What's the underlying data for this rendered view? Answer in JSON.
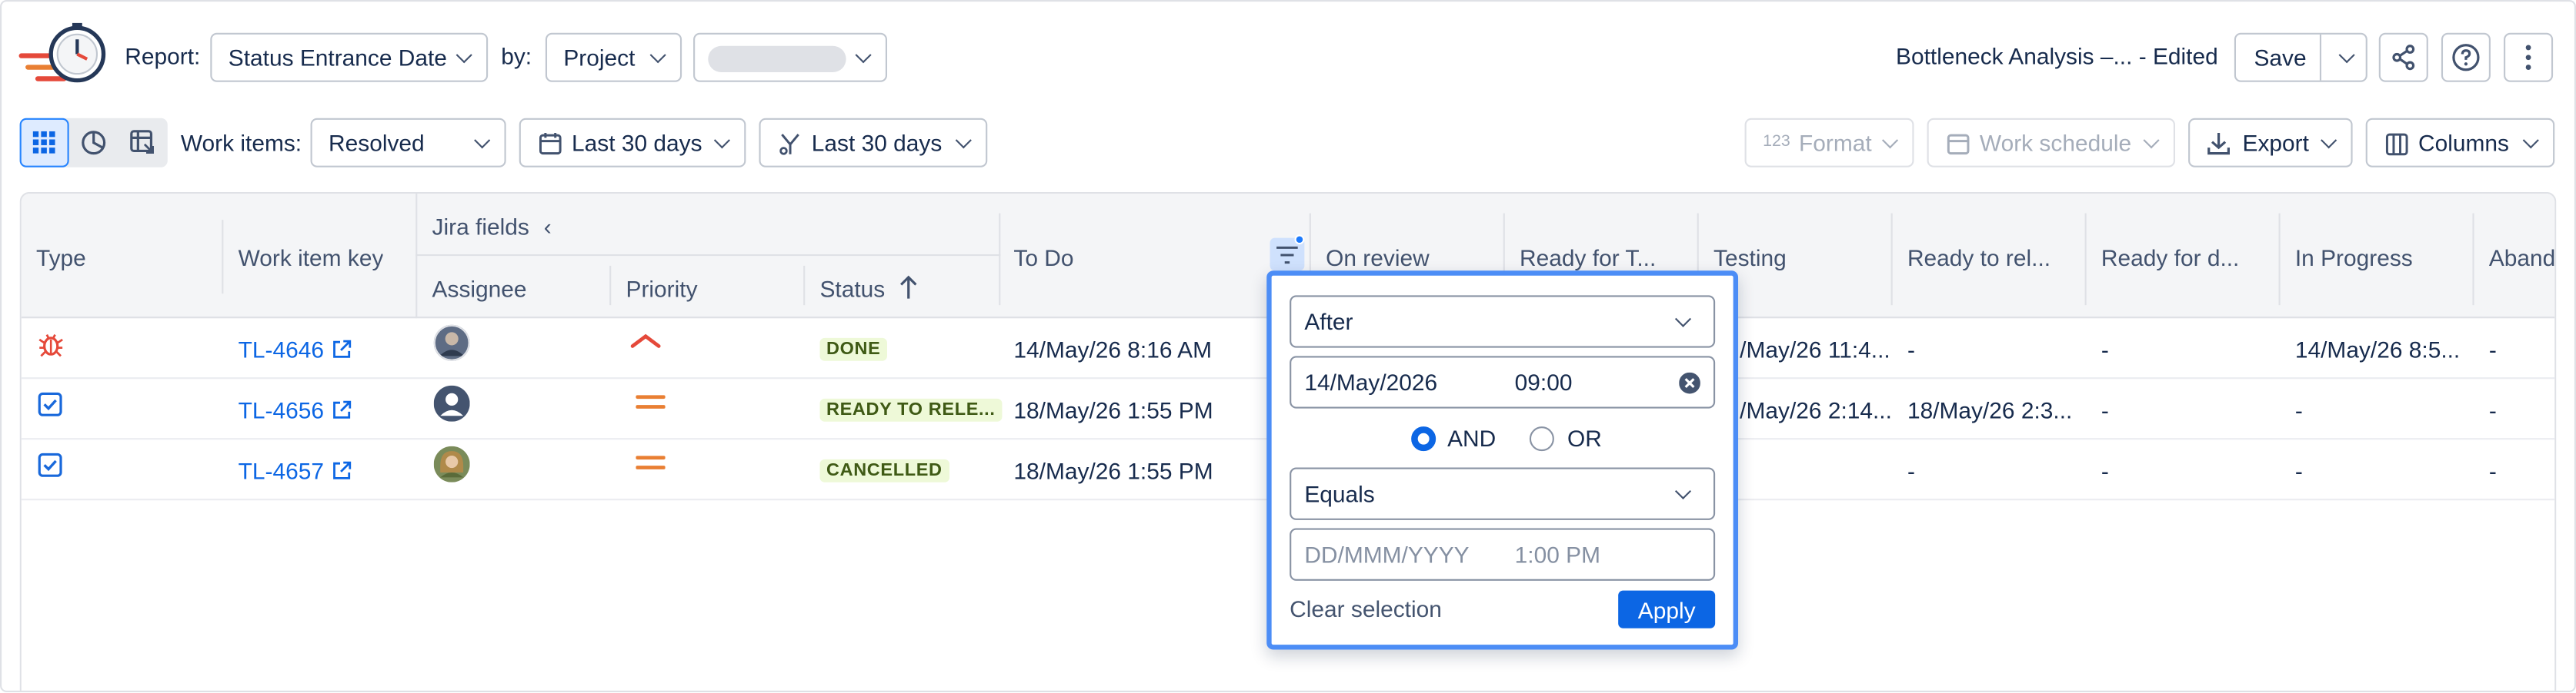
{
  "toolbar": {
    "report_label": "Report:",
    "report_value": "Status Entrance Date",
    "by_label": "by:",
    "by_value": "Project",
    "report_name": "Bottleneck Analysis –... - Edited",
    "save_label": "Save"
  },
  "filters": {
    "work_items_label": "Work items:",
    "work_items_value": "Resolved",
    "date_range_1": "Last 30 days",
    "date_range_2": "Last 30 days",
    "format_label": "Format",
    "work_schedule_label": "Work schedule",
    "export_label": "Export",
    "columns_label": "Columns"
  },
  "table": {
    "headers": {
      "type": "Type",
      "work_item_key": "Work item key",
      "jira_fields": "Jira fields",
      "assignee": "Assignee",
      "priority": "Priority",
      "status": "Status",
      "to_do": "To Do",
      "on_review": "On review",
      "ready_for_t": "Ready for T...",
      "testing": "Testing",
      "ready_to_rel": "Ready to rel...",
      "ready_for_d": "Ready for d...",
      "in_progress": "In Progress",
      "aband": "Aband"
    },
    "rows": [
      {
        "type_icon": "bug-icon",
        "key": "TL-4646",
        "priority_icon": "priority-high-icon",
        "status": "DONE",
        "to_do": "14/May/26 8:16 AM",
        "testing": "/May/26 11:4...",
        "ready_to_rel": "-",
        "ready_for_d": "-",
        "in_progress": "14/May/26 8:5...",
        "aband": "-"
      },
      {
        "type_icon": "task-icon",
        "key": "TL-4656",
        "priority_icon": "priority-medium-icon",
        "status": "READY TO RELE...",
        "to_do": "18/May/26 1:55 PM",
        "testing": "/May/26 2:14...",
        "ready_to_rel": "18/May/26 2:3...",
        "ready_for_d": "-",
        "in_progress": "-",
        "aband": "-"
      },
      {
        "type_icon": "task-icon",
        "key": "TL-4657",
        "priority_icon": "priority-medium-icon",
        "status": "CANCELLED",
        "to_do": "18/May/26 1:55 PM",
        "testing": "",
        "ready_to_rel": "-",
        "ready_for_d": "-",
        "in_progress": "-",
        "aband": "-"
      }
    ]
  },
  "date_filter": {
    "condition_1": "After",
    "date_1": "14/May/2026",
    "time_1": "09:00",
    "and_label": "AND",
    "or_label": "OR",
    "selected_operator": "AND",
    "condition_2": "Equals",
    "date_placeholder": "DD/MMM/YYYY",
    "time_placeholder": "1:00 PM",
    "clear_label": "Clear selection",
    "apply_label": "Apply"
  },
  "colors": {
    "accent": "#0c66e4",
    "popup_border": "#4c8df6",
    "bug": "#e5493a",
    "priority_high": "#e5493a",
    "priority_medium": "#e97f33",
    "lozenge_bg": "#eef9d8"
  }
}
